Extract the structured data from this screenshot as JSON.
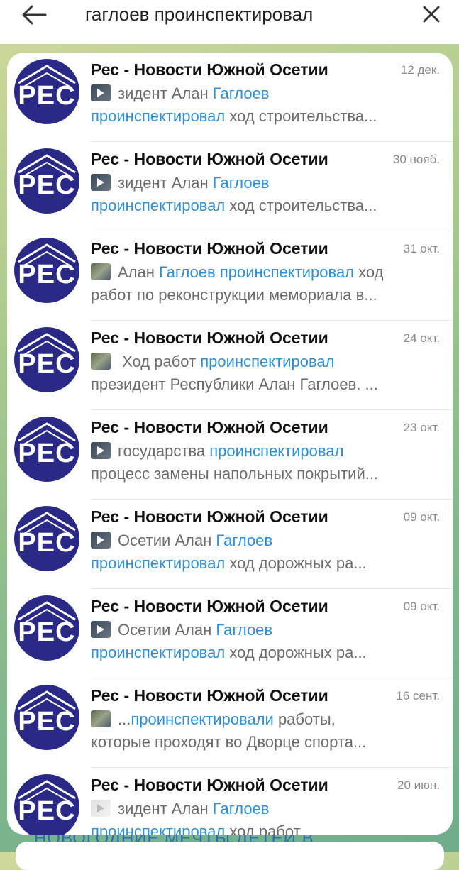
{
  "search": {
    "query": "гаглоев проинспектировал",
    "back_icon": "arrow-left-icon",
    "clear_icon": "close-icon"
  },
  "colors": {
    "highlight": "#2e8fd6",
    "avatar_bg": "#2a2a86"
  },
  "avatar": {
    "text": "РЕС"
  },
  "results": [
    {
      "name": "Рес - Новости Южной Осетии",
      "date": "12 дек.",
      "thumb": "video",
      "line1": [
        {
          "t": "зидент Алан ",
          "h": false
        },
        {
          "t": "Гаглоев",
          "h": true
        }
      ],
      "line2": [
        {
          "t": "проинспектировал",
          "h": true
        },
        {
          "t": " ход строительства...",
          "h": false
        }
      ]
    },
    {
      "name": "Рес - Новости Южной Осетии",
      "date": "30 нояб.",
      "thumb": "video",
      "line1": [
        {
          "t": "зидент Алан ",
          "h": false
        },
        {
          "t": "Гаглоев",
          "h": true
        }
      ],
      "line2": [
        {
          "t": "проинспектировал",
          "h": true
        },
        {
          "t": " ход строительства...",
          "h": false
        }
      ]
    },
    {
      "name": "Рес - Новости Южной Осетии",
      "date": "31 окт.",
      "thumb": "photo",
      "line1": [
        {
          "t": "Алан ",
          "h": false
        },
        {
          "t": "Гаглоев проинспектировал",
          "h": true
        },
        {
          "t": " ход",
          "h": false
        }
      ],
      "line2": [
        {
          "t": "работ по реконструкции мемориала в...",
          "h": false
        }
      ]
    },
    {
      "name": "Рес - Новости Южной Осетии",
      "date": "24 окт.",
      "thumb": "photo",
      "line1": [
        {
          "t": " Ход работ ",
          "h": false
        },
        {
          "t": "проинспектировал",
          "h": true
        }
      ],
      "line2": [
        {
          "t": "президент Республики Алан Гаглоев.  ...",
          "h": false
        }
      ]
    },
    {
      "name": "Рес - Новости Южной Осетии",
      "date": "23 окт.",
      "thumb": "video",
      "line1": [
        {
          "t": "государства ",
          "h": false
        },
        {
          "t": "проинспектировал",
          "h": true
        }
      ],
      "line2": [
        {
          "t": "процесс замены напольных покрытий...",
          "h": false
        }
      ]
    },
    {
      "name": "Рес - Новости Южной Осетии",
      "date": "09 окт.",
      "thumb": "video",
      "line1": [
        {
          "t": "Осетии Алан ",
          "h": false
        },
        {
          "t": "Гаглоев",
          "h": true
        }
      ],
      "line2": [
        {
          "t": "проинспектировал",
          "h": true
        },
        {
          "t": " ход дорожных ра...",
          "h": false
        }
      ]
    },
    {
      "name": "Рес - Новости Южной Осетии",
      "date": "09 окт.",
      "thumb": "video",
      "line1": [
        {
          "t": "Осетии Алан ",
          "h": false
        },
        {
          "t": "Гаглоев",
          "h": true
        }
      ],
      "line2": [
        {
          "t": "проинспектировал",
          "h": true
        },
        {
          "t": " ход дорожных ра...",
          "h": false
        }
      ]
    },
    {
      "name": "Рес - Новости Южной Осетии",
      "date": "16 сент.",
      "thumb": "photo",
      "line1": [
        {
          "t": "...",
          "h": false
        },
        {
          "t": "проинспектировали",
          "h": true
        },
        {
          "t": " работы,",
          "h": false
        }
      ],
      "line2": [
        {
          "t": "которые проходят во Дворце спорта...",
          "h": false
        }
      ]
    },
    {
      "name": "Рес - Новости Южной Осетии",
      "date": "20 июн.",
      "thumb": "video-light",
      "line1": [
        {
          "t": "зидент Алан ",
          "h": false
        },
        {
          "t": "Гаглоев",
          "h": true
        }
      ],
      "line2": [
        {
          "t": "проинспектировал",
          "h": true
        },
        {
          "t": " ход работ  ...",
          "h": false
        }
      ]
    }
  ],
  "background_text": "НОВОГОДНИЕ МЕЧТЫ ДЕТЕЙ В"
}
